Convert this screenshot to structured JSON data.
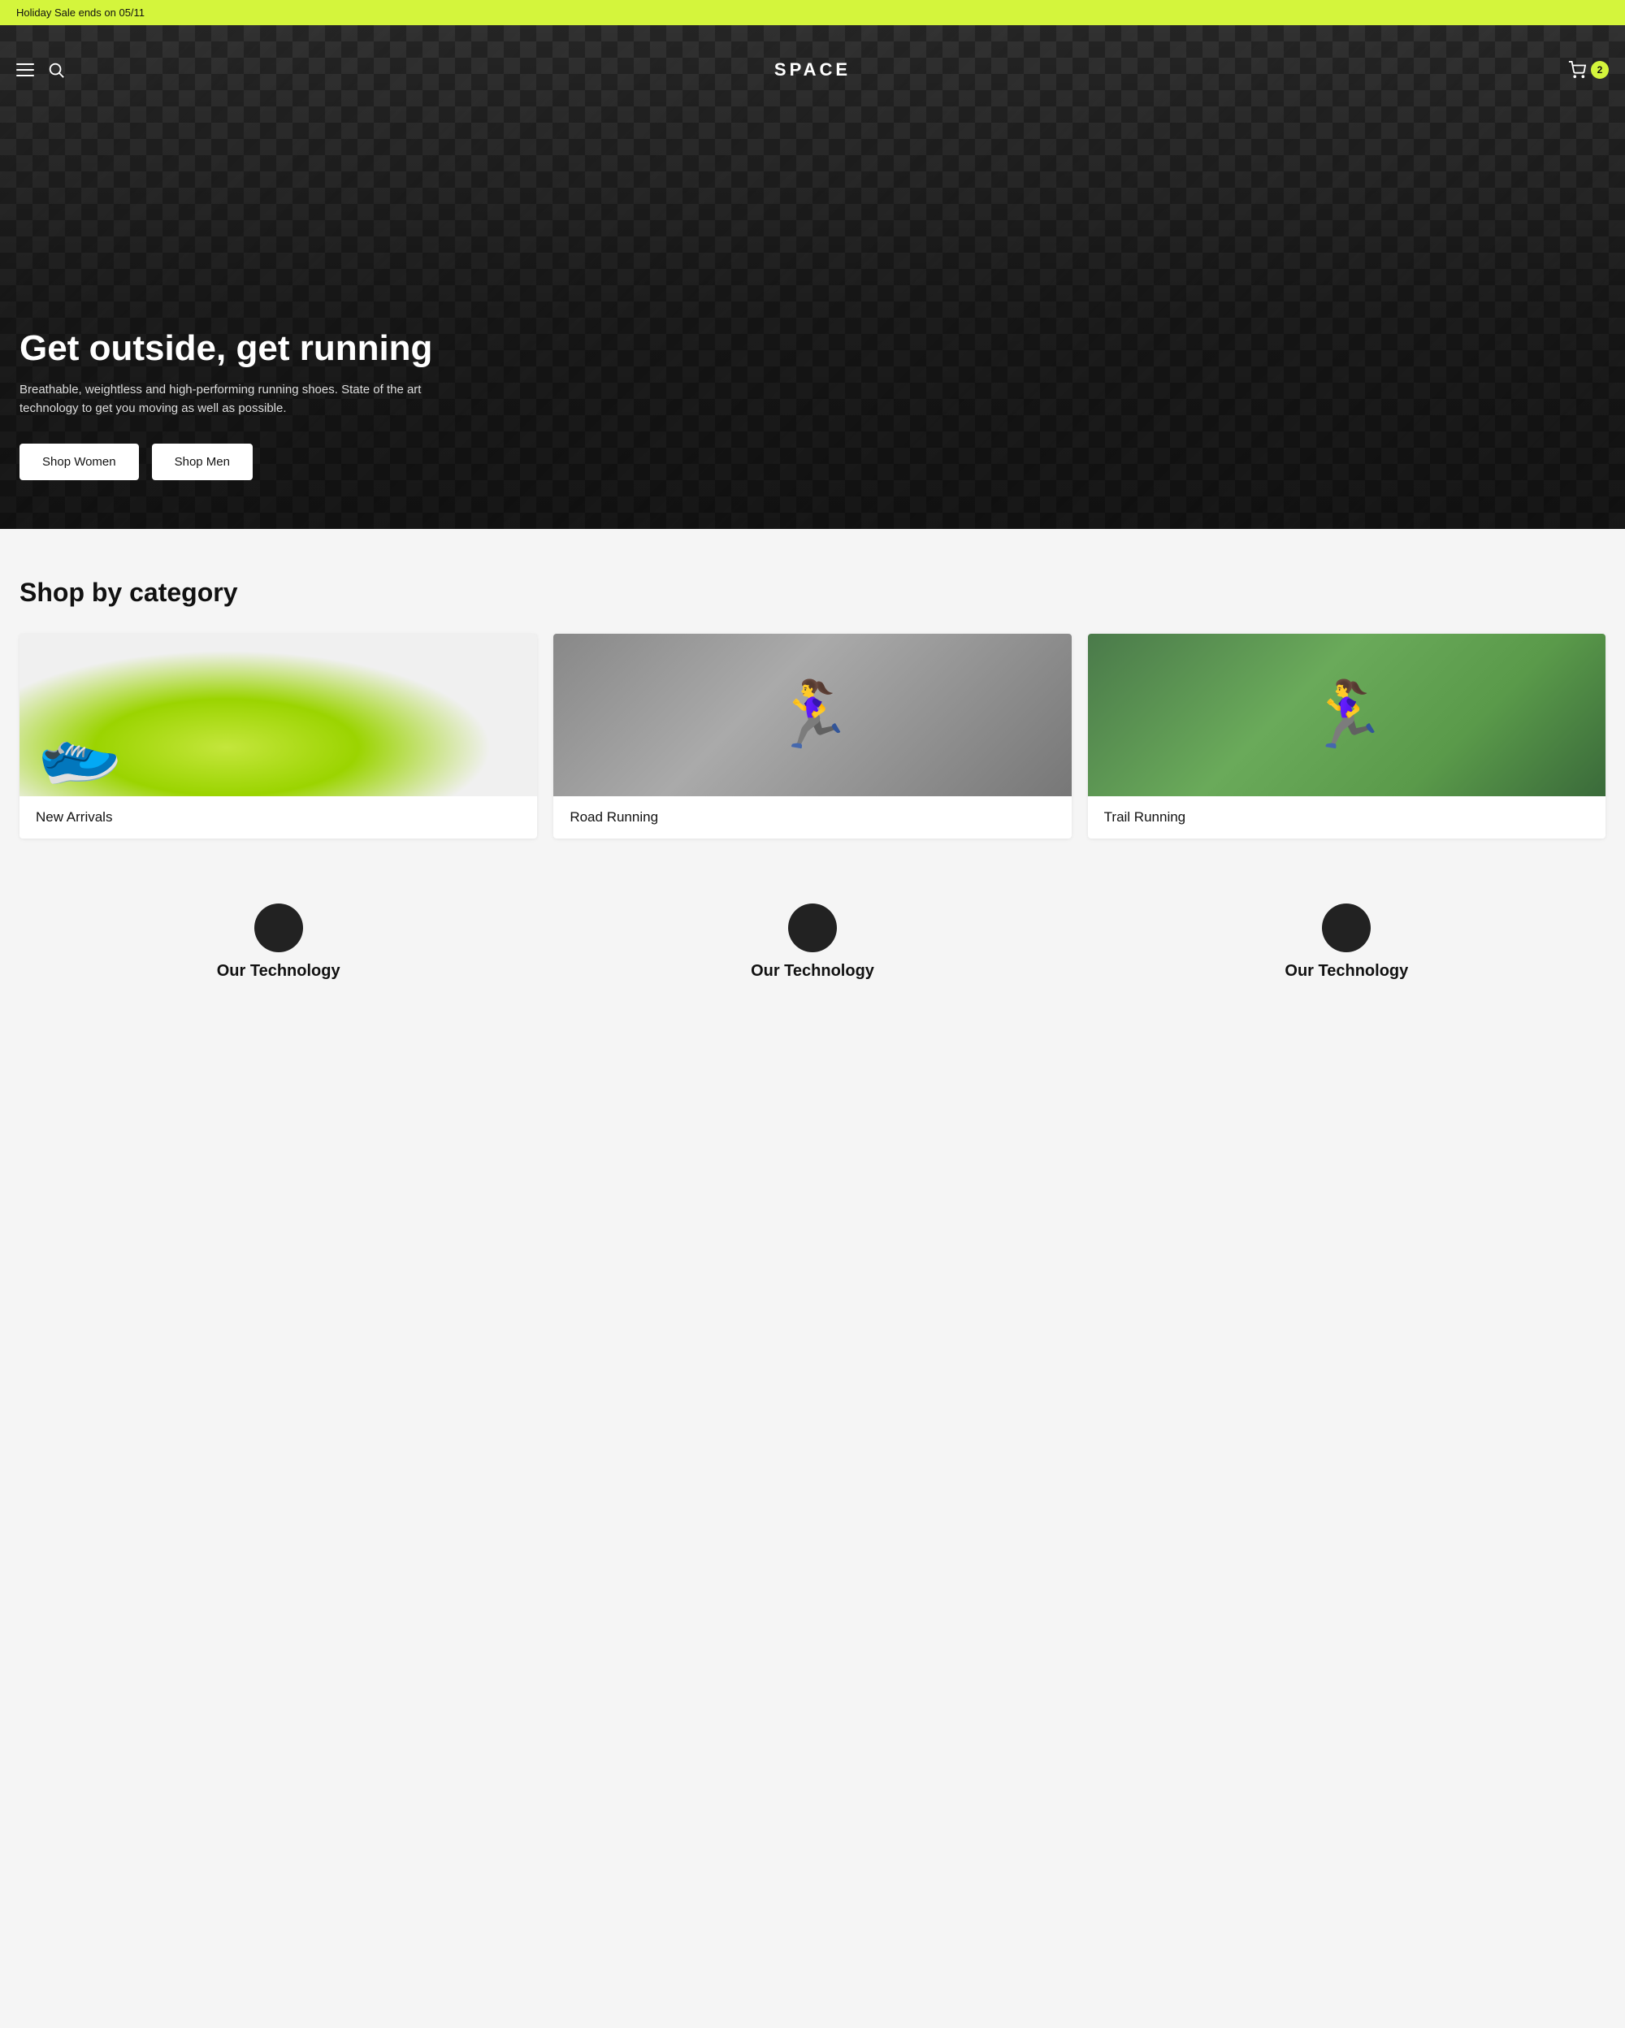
{
  "announcement": {
    "text": "Holiday Sale ends on 05/11"
  },
  "header": {
    "logo": "SPACE",
    "cart_count": "2",
    "menu_label": "menu",
    "search_label": "search",
    "cart_label": "cart"
  },
  "hero": {
    "title": "Get outside, get running",
    "subtitle": "Breathable, weightless and high-performing running shoes. State of the art technology to get you moving as well as possible.",
    "btn_women": "Shop Women",
    "btn_men": "Shop Men"
  },
  "category_section": {
    "title": "Shop by category",
    "items": [
      {
        "label": "New Arrivals",
        "img_key": "new-arrivals"
      },
      {
        "label": "Road Running",
        "img_key": "road-running"
      },
      {
        "label": "Trail Running",
        "img_key": "trail-running"
      }
    ]
  },
  "technology_section": {
    "title": "Our Technology"
  }
}
